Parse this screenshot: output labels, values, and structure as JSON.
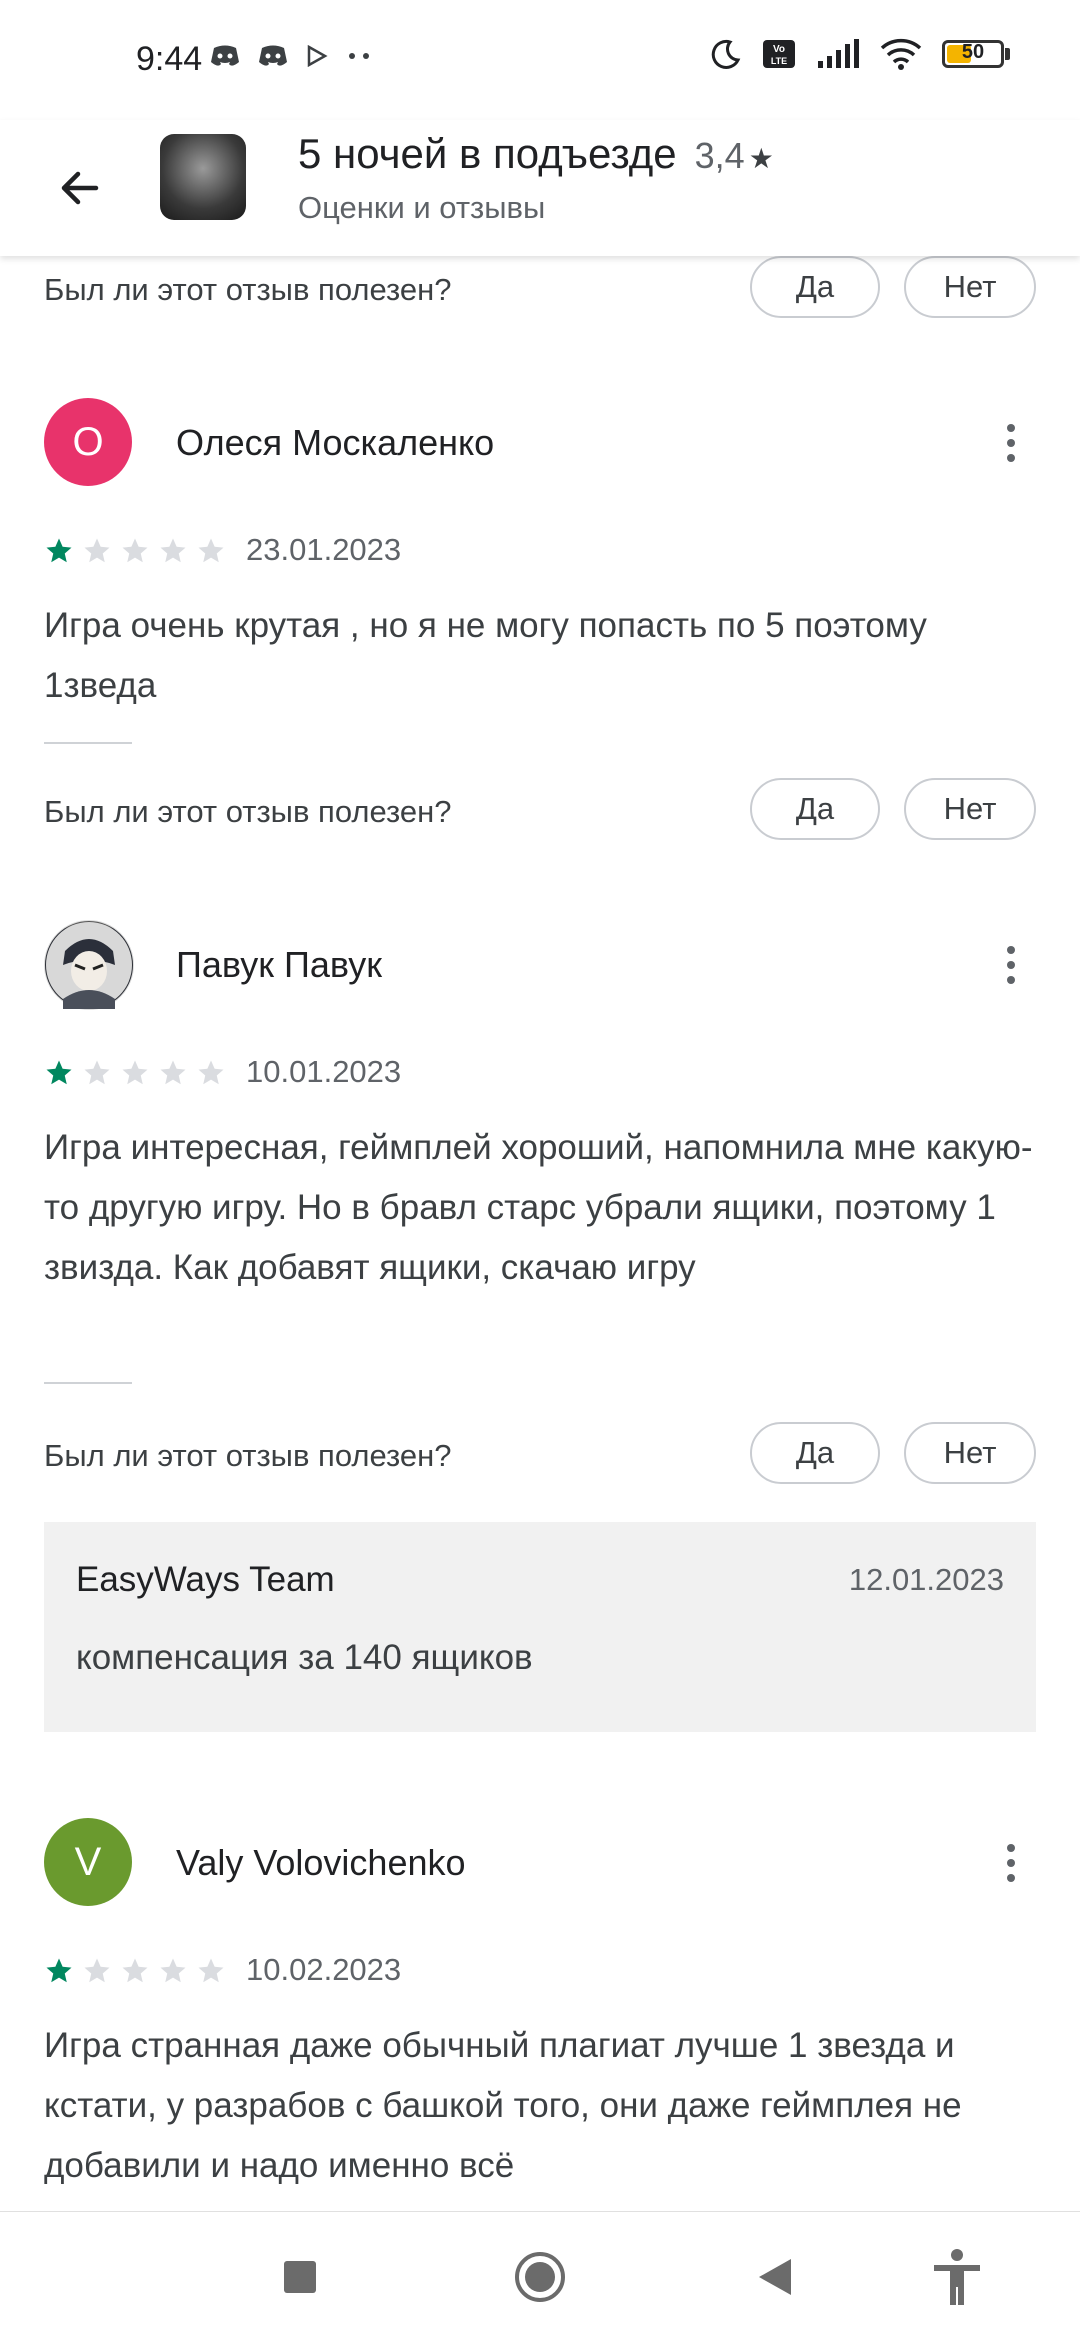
{
  "status_bar": {
    "time": "9:44",
    "battery": "50",
    "battery_level": 0.5,
    "icons": [
      "discord-icon",
      "discord-icon",
      "play-icon",
      "more-dots-icon",
      "moon-icon",
      "volte-icon",
      "signal-icon",
      "wifi-icon",
      "battery-icon"
    ]
  },
  "header": {
    "title": "5 ночей в подъезде",
    "rating": "3,4",
    "subtitle": "Оценки и отзывы"
  },
  "helpful": {
    "question": "Был ли этот отзыв полезен?",
    "yes": "Да",
    "no": "Нет"
  },
  "reviews": [
    {
      "author": "Олеся Москаленко",
      "avatar_letter": "О",
      "avatar_color": "#e8336b",
      "rating": 1,
      "date": "23.01.2023",
      "text": "Игра очень крутая , но я не могу попасть по 5 поэтому 1зведа"
    },
    {
      "author": "Павук Павук",
      "avatar_letter": "",
      "avatar_color": "#8a8f99",
      "rating": 1,
      "date": "10.01.2023",
      "text": "Игра интересная, геймплей хороший, напомнила мне какую-то другую игру. Но в бравл старс убрали ящики, поэтому 1 звизда. Как добавят ящики, скачаю игру",
      "developer_reply": {
        "name": "EasyWays Team",
        "date": "12.01.2023",
        "text": "компенсация за 140 ящиков"
      }
    },
    {
      "author": "Valy Volovichenko",
      "avatar_letter": "V",
      "avatar_color": "#6a9a2e",
      "rating": 1,
      "date": "10.02.2023",
      "text": "Игра странная даже обычный плагиат лучше 1 звезда и кстати, у разрабов с башкой того, они даже геймплея не добавили и надо именно всё"
    }
  ],
  "colors": {
    "star_filled": "#01875f",
    "star_empty": "#dadce0",
    "accent": "#01875f"
  },
  "nav_bar": {
    "icons": [
      "square-icon",
      "circle-icon",
      "triangle-back-icon",
      "accessibility-icon"
    ]
  }
}
